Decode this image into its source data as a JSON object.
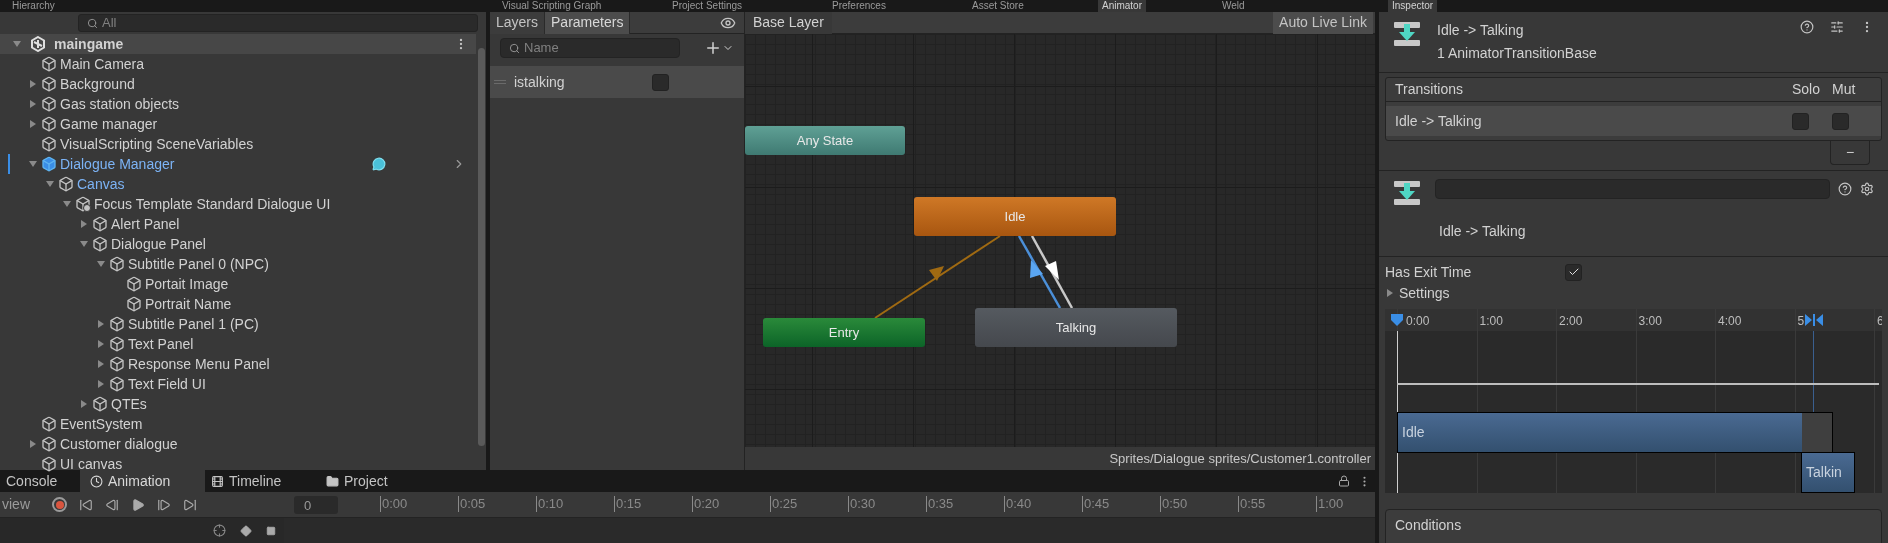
{
  "top_tabs": [
    {
      "label": "Hierarchy",
      "selected": false
    },
    {
      "label": "Visual Scripting Graph",
      "selected": false
    },
    {
      "label": "Project Settings",
      "selected": false
    },
    {
      "label": "Preferences",
      "selected": false
    },
    {
      "label": "Asset Store",
      "selected": false
    },
    {
      "label": "Animator",
      "selected": true
    },
    {
      "label": "Weld",
      "selected": false
    },
    {
      "label": "Inspector",
      "selected": true
    }
  ],
  "hierarchy": {
    "search": {
      "placeholder": "All"
    },
    "scene": "maingame",
    "items": [
      {
        "label": "Main Camera",
        "kind": "object",
        "highlighted": false
      },
      {
        "label": "Background",
        "kind": "object",
        "highlighted": false,
        "expanded": false
      },
      {
        "label": "Gas station objects",
        "kind": "object",
        "highlighted": false,
        "expanded": false
      },
      {
        "label": "Game manager",
        "kind": "object",
        "highlighted": false,
        "expanded": false
      },
      {
        "label": "VisualScripting SceneVariables",
        "kind": "object",
        "highlighted": false
      },
      {
        "label": "Dialogue Manager",
        "kind": "prefab_root",
        "highlighted": true,
        "expanded": true,
        "children": [
          {
            "label": "Canvas",
            "kind": "object",
            "highlighted": true,
            "expanded": true,
            "children": [
              {
                "label": "Focus Template Standard Dialogue UI",
                "kind": "variant",
                "highlighted": false,
                "expanded": true,
                "children": [
                  {
                    "label": "Alert Panel",
                    "kind": "object",
                    "highlighted": false,
                    "expanded": false
                  },
                  {
                    "label": "Dialogue Panel",
                    "kind": "object",
                    "highlighted": false,
                    "expanded": true,
                    "children": [
                      {
                        "label": "Subtitle Panel 0 (NPC)",
                        "kind": "object",
                        "highlighted": false,
                        "expanded": true,
                        "children": [
                          {
                            "label": "Portait Image",
                            "kind": "object",
                            "highlighted": false
                          },
                          {
                            "label": "Portrait Name",
                            "kind": "object",
                            "highlighted": false
                          }
                        ]
                      },
                      {
                        "label": "Subtitle Panel 1 (PC)",
                        "kind": "object",
                        "highlighted": false,
                        "expanded": false
                      },
                      {
                        "label": "Text Panel",
                        "kind": "object",
                        "highlighted": false,
                        "expanded": false
                      },
                      {
                        "label": "Response Menu Panel",
                        "kind": "object",
                        "highlighted": false,
                        "expanded": false
                      },
                      {
                        "label": "Text Field UI",
                        "kind": "object",
                        "highlighted": false,
                        "expanded": false
                      }
                    ]
                  },
                  {
                    "label": "QTEs",
                    "kind": "object",
                    "highlighted": false,
                    "expanded": false
                  }
                ]
              }
            ]
          }
        ]
      },
      {
        "label": "EventSystem",
        "kind": "object",
        "highlighted": false
      },
      {
        "label": "Customer dialogue",
        "kind": "object",
        "highlighted": false,
        "expanded": false
      },
      {
        "label": "UI canvas",
        "kind": "object",
        "highlighted": false
      }
    ]
  },
  "animator": {
    "tabs": [
      {
        "label": "Layers",
        "selected": false
      },
      {
        "label": "Parameters",
        "selected": true
      }
    ],
    "search": {
      "placeholder": "Name"
    },
    "parameters": [
      {
        "name": "istalking",
        "checked": false
      }
    ],
    "breadcrumb": "Base Layer",
    "live_link": "Auto Live Link",
    "nodes": [
      {
        "label": "Any State",
        "kind": "any"
      },
      {
        "label": "Idle",
        "kind": "default"
      },
      {
        "label": "Entry",
        "kind": "entry"
      },
      {
        "label": "Talking",
        "kind": "state"
      }
    ],
    "transitions": [
      {
        "kind": "entry"
      },
      {
        "kind": "back"
      },
      {
        "kind": "forward"
      }
    ],
    "path": "Sprites/Dialogue sprites/Customer1.controller"
  },
  "inspector": {
    "title": "Idle -> Talking",
    "subtitle": "1 AnimatorTransitionBase",
    "list": {
      "header": "Transitions",
      "columns": [
        "Solo",
        "Mut"
      ],
      "rows": [
        {
          "label": "Idle -> Talking",
          "solo": false,
          "mute": false,
          "selected": true
        }
      ],
      "remove": "−"
    },
    "transition_label": "Idle -> Talking",
    "has_exit_time": {
      "label": "Has Exit Time",
      "checked": true
    },
    "settings": {
      "label": "Settings",
      "expanded": false
    },
    "timeline": {
      "ticks": [
        "0:00",
        "1:00",
        "2:00",
        "3:00",
        "4:00",
        "5",
        "6"
      ],
      "clips": [
        {
          "label": "Idle",
          "kind": "source"
        },
        {
          "label": "Talkin",
          "kind": "target"
        }
      ]
    },
    "conditions": "Conditions"
  },
  "bottom": {
    "tabs": [
      {
        "label": "Console",
        "selected": false
      },
      {
        "label": "Animation",
        "selected": true
      },
      {
        "label": "Timeline",
        "selected": false
      },
      {
        "label": "Project",
        "selected": false
      }
    ],
    "preview": "view",
    "frame": "0",
    "ticks": [
      "0:00",
      "0:05",
      "0:10",
      "0:15",
      "0:20",
      "0:25",
      "0:30",
      "0:35",
      "0:40",
      "0:45",
      "0:50",
      "0:55",
      "1:00"
    ]
  }
}
